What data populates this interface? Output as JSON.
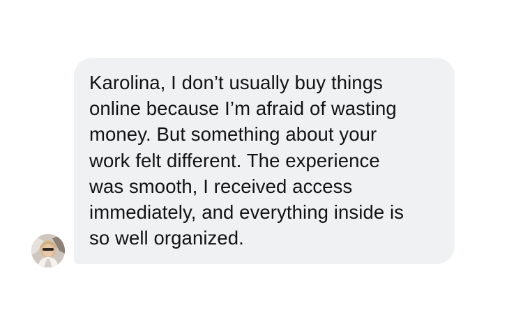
{
  "conversation": {
    "sender": {
      "avatar_icon": "sender-profile-photo"
    },
    "message": {
      "lines": [
        "Karolina, I don’t usually buy things",
        "online because I’m afraid of wasting",
        "money. But something about your",
        "work felt different. The experience",
        "was smooth, I received access",
        "immediately, and everything inside is",
        "so well organized."
      ],
      "bubble_color": "#f0f1f3",
      "text_color": "#121212"
    }
  }
}
